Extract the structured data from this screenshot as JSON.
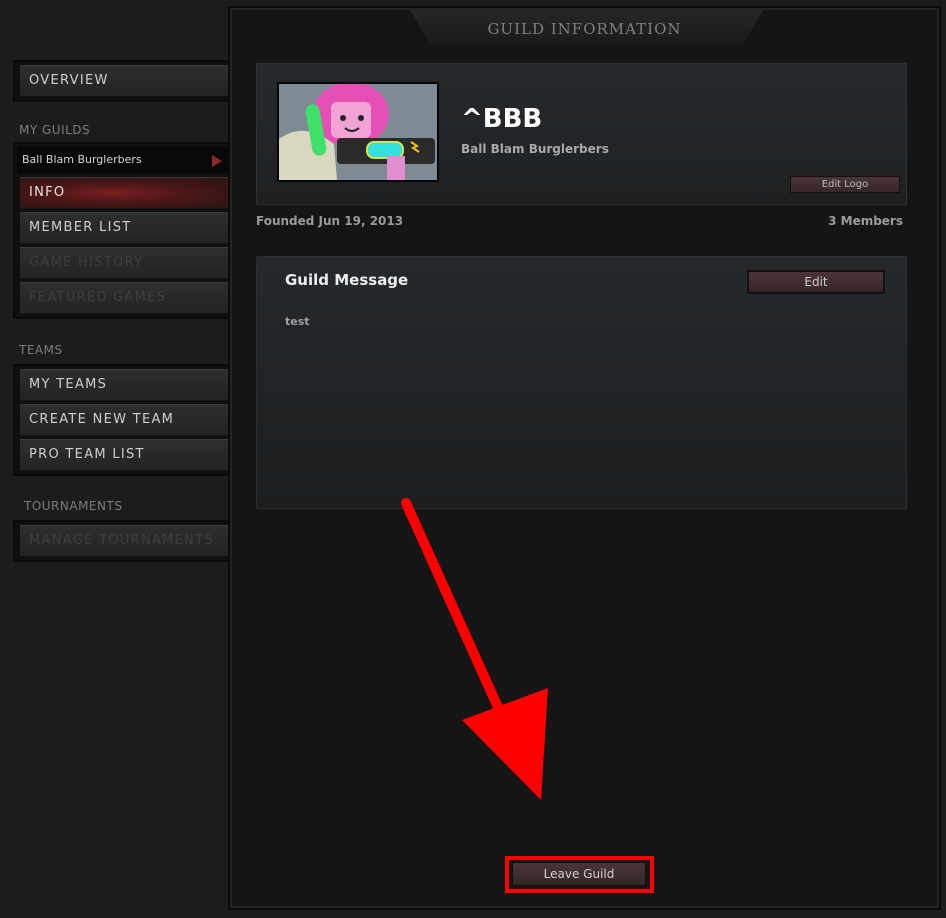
{
  "sidebar": {
    "overview_label": "OVERVIEW",
    "my_guilds_label": "MY GUILDS",
    "selected_guild": "Ball Blam Burglerbers",
    "guild_nav": [
      {
        "label": "INFO"
      },
      {
        "label": "MEMBER LIST"
      },
      {
        "label": "GAME HISTORY"
      },
      {
        "label": "FEATURED GAMES"
      }
    ],
    "teams_label": "TEAMS",
    "team_nav": [
      {
        "label": "MY TEAMS"
      },
      {
        "label": "CREATE NEW TEAM"
      },
      {
        "label": "PRO TEAM LIST"
      }
    ],
    "tournaments_label": "TOURNAMENTS",
    "manage_tournaments_label": "MANAGE TOURNAMENTS"
  },
  "panel": {
    "title": "GUILD INFORMATION"
  },
  "guild": {
    "tag": "^BBB",
    "name": "Ball Blam Burglerbers",
    "edit_logo_label": "Edit Logo",
    "founded": "Founded Jun 19, 2013",
    "members": "3 Members"
  },
  "message": {
    "heading": "Guild Message",
    "edit_label": "Edit",
    "text": "test"
  },
  "actions": {
    "leave_label": "Leave Guild"
  },
  "colors": {
    "accent_red": "#ff0000",
    "active_nav": "#7a2020",
    "button_bg": "#4a3536"
  }
}
